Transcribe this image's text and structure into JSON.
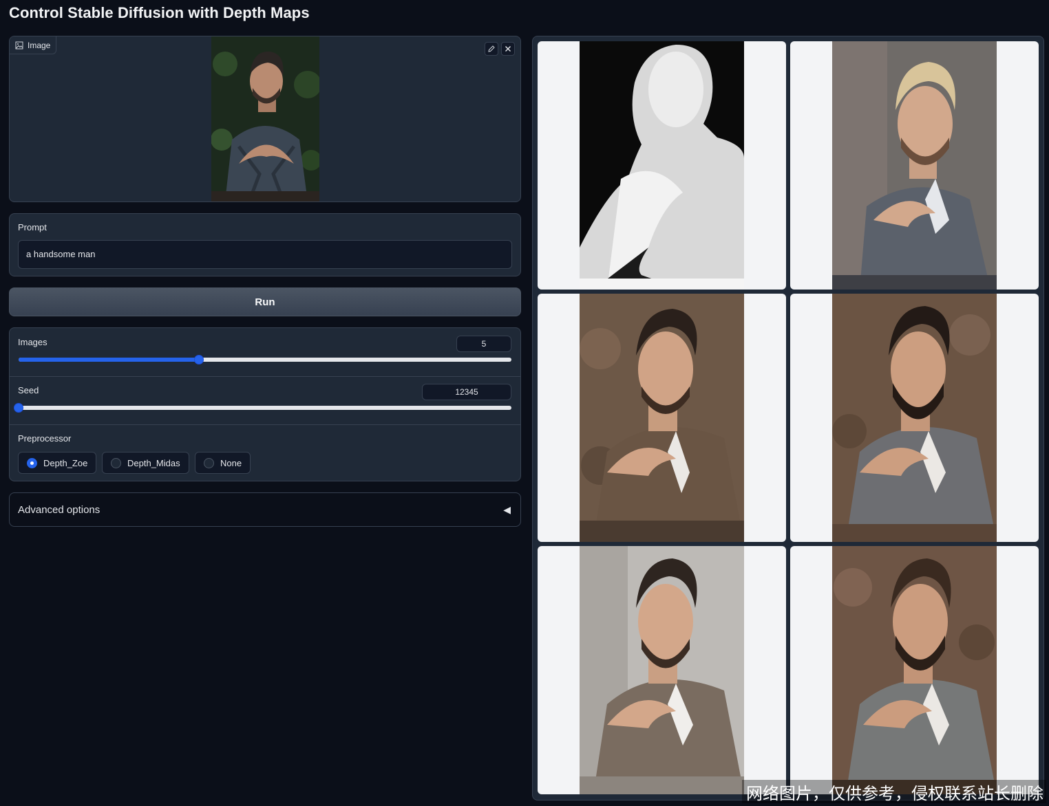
{
  "app": {
    "title": "Control Stable Diffusion with Depth Maps"
  },
  "image_input": {
    "label": "Image",
    "label_icon": "image-icon",
    "edit_icon": "pencil-icon",
    "clear_icon": "close-icon"
  },
  "prompt": {
    "label": "Prompt",
    "value": "a handsome man"
  },
  "run": {
    "label": "Run"
  },
  "images_slider": {
    "label": "Images",
    "value": "5",
    "fraction": 0.366
  },
  "seed_slider": {
    "label": "Seed",
    "value": "12345",
    "fraction": 0.0
  },
  "preprocessor": {
    "label": "Preprocessor",
    "options": [
      "Depth_Zoe",
      "Depth_Midas",
      "None"
    ],
    "selected": "Depth_Zoe"
  },
  "advanced": {
    "label": "Advanced options",
    "caret": "◀"
  },
  "gallery": {
    "items": [
      "depth-map",
      "generated-1",
      "generated-2",
      "generated-3",
      "generated-4",
      "generated-5"
    ]
  },
  "watermark": {
    "text": "网络图片，仅供参考，侵权联系站长删除"
  },
  "colors": {
    "accent": "#2563eb",
    "background": "#0b0f19",
    "panel": "#1f2937",
    "border": "#374151"
  }
}
